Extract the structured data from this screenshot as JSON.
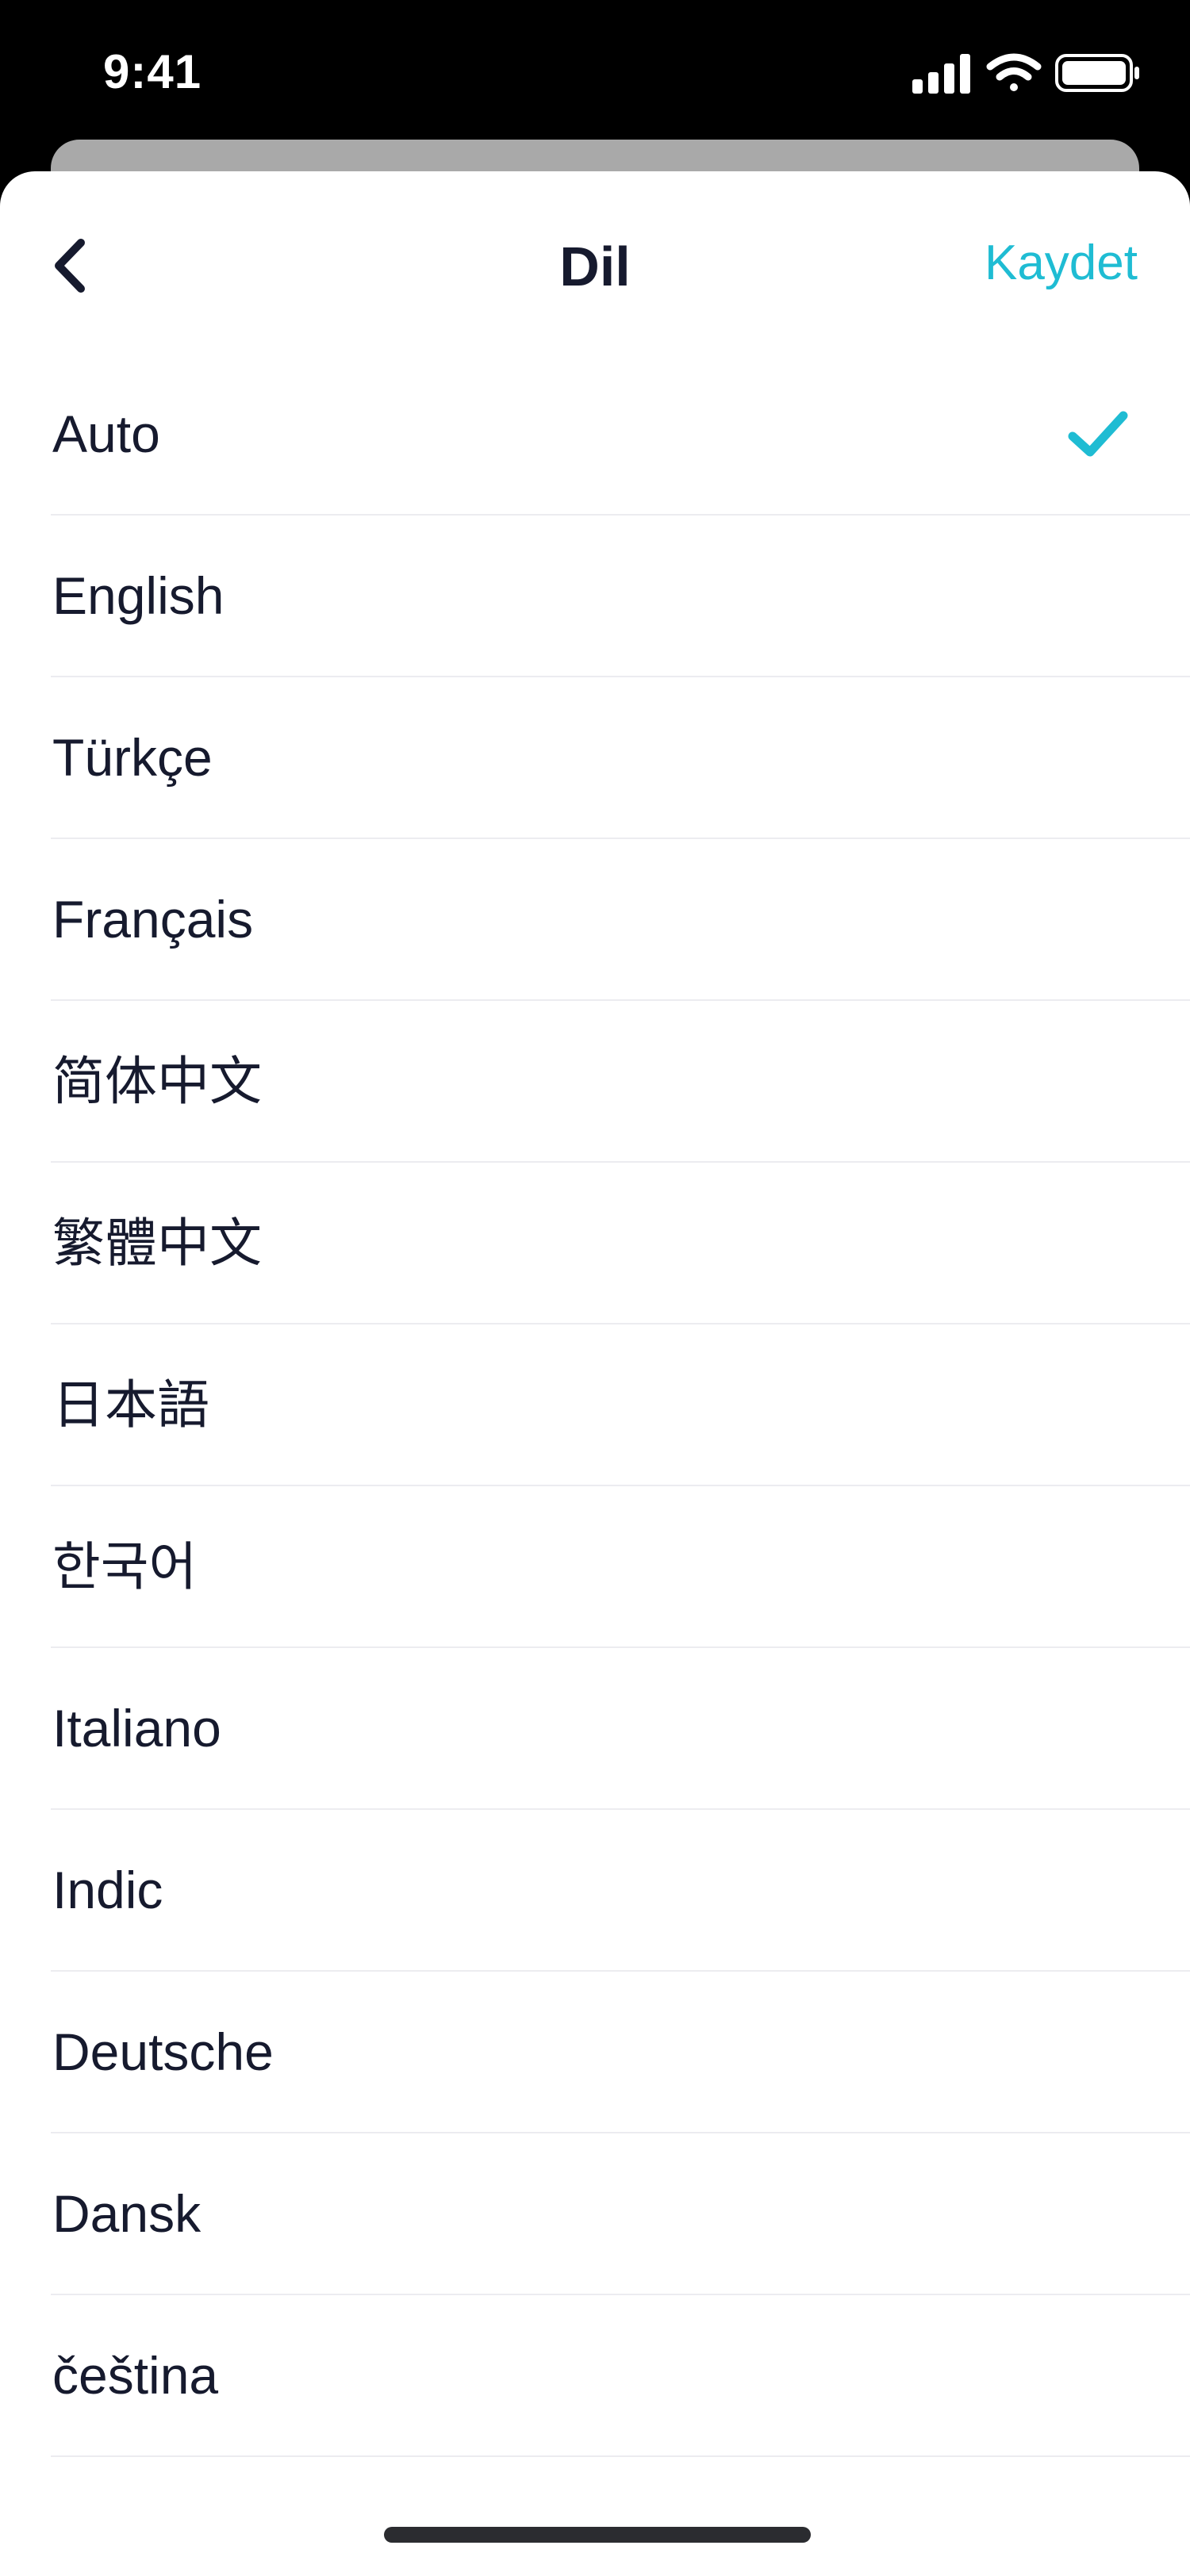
{
  "status_bar": {
    "time": "9:41",
    "icons": [
      "cellular-signal-icon",
      "wifi-icon",
      "battery-icon"
    ]
  },
  "nav": {
    "back_icon": "chevron-left-icon",
    "title": "Dil",
    "save_label": "Kaydet"
  },
  "languages": [
    {
      "label": "Auto",
      "selected": true
    },
    {
      "label": "English",
      "selected": false
    },
    {
      "label": "Türkçe",
      "selected": false
    },
    {
      "label": "Français",
      "selected": false
    },
    {
      "label": "简体中文",
      "selected": false
    },
    {
      "label": "繁體中文",
      "selected": false
    },
    {
      "label": "日本語",
      "selected": false
    },
    {
      "label": "한국어",
      "selected": false
    },
    {
      "label": "Italiano",
      "selected": false
    },
    {
      "label": "Indic",
      "selected": false
    },
    {
      "label": "Deutsche",
      "selected": false
    },
    {
      "label": "Dansk",
      "selected": false
    },
    {
      "label": "čeština",
      "selected": false
    }
  ],
  "colors": {
    "accent": "#1fbcd3",
    "text": "#161a2e",
    "divider": "#ececf0",
    "status_bar_bg": "#000000"
  }
}
